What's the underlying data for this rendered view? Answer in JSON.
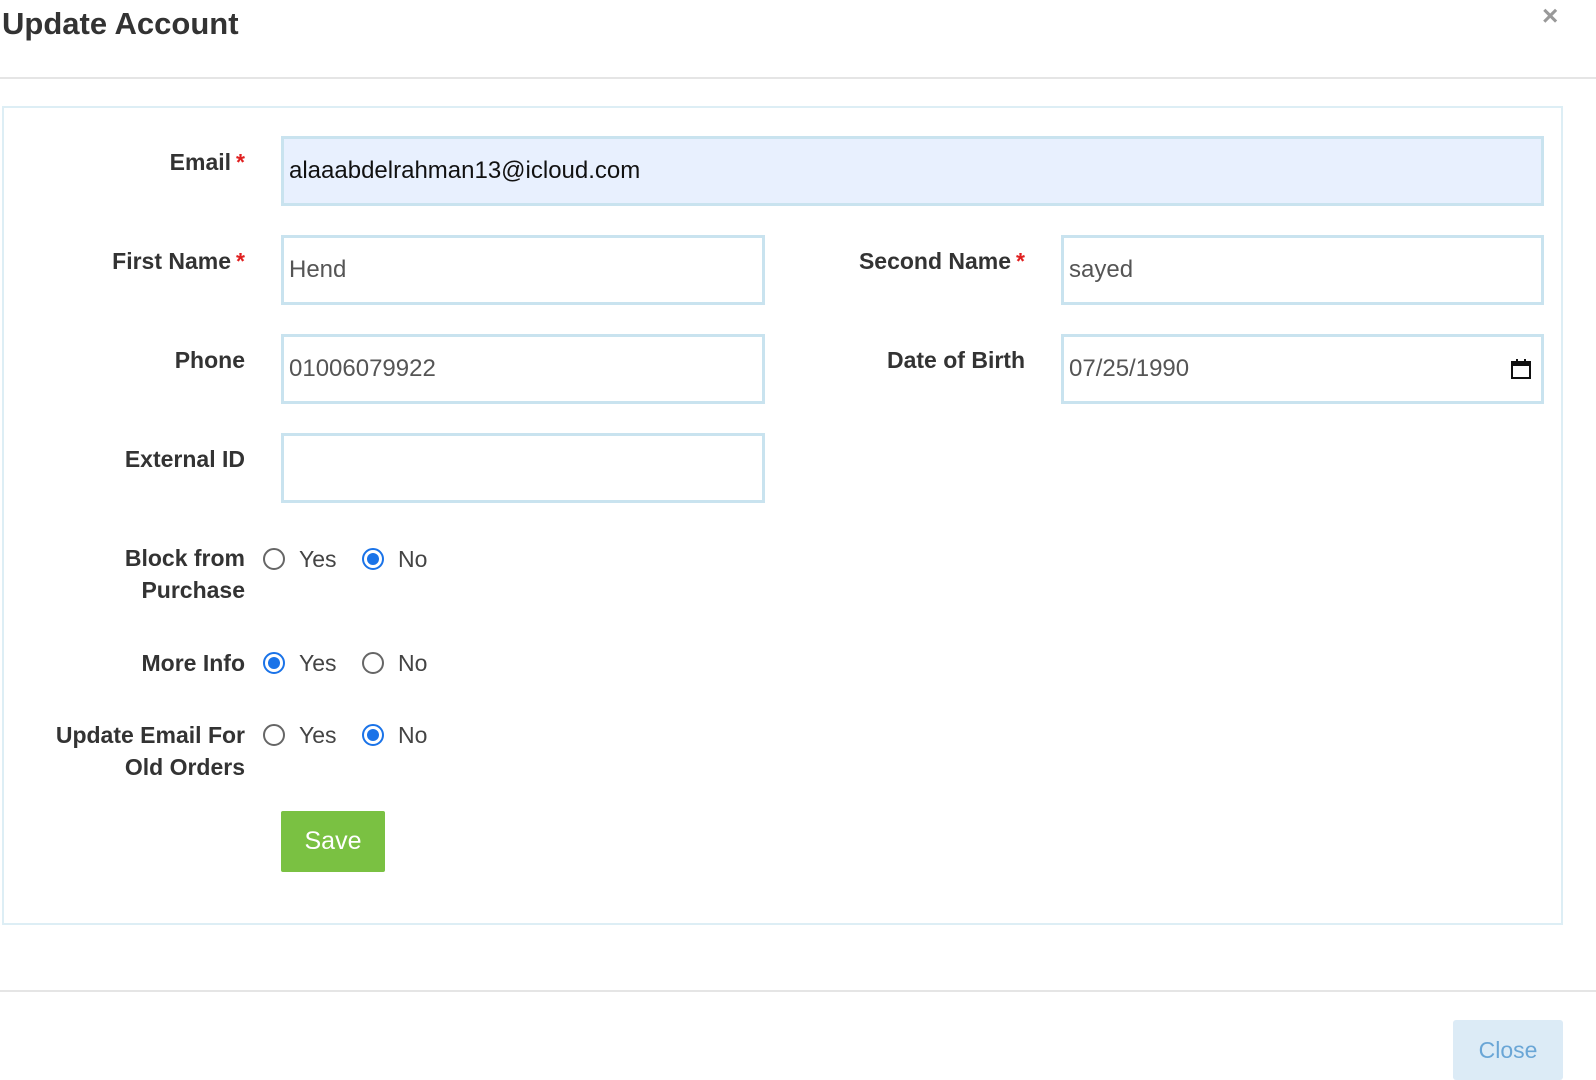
{
  "modal": {
    "title": "Update Account",
    "close_symbol": "×"
  },
  "form": {
    "email": {
      "label": "Email",
      "required_mark": "*",
      "value": "alaaabdelrahman13@icloud.com"
    },
    "first_name": {
      "label": "First Name",
      "required_mark": "*",
      "value": "Hend"
    },
    "second_name": {
      "label": "Second Name",
      "required_mark": "*",
      "value": "sayed"
    },
    "phone": {
      "label": "Phone",
      "value": "01006079922"
    },
    "date_of_birth": {
      "label": "Date of Birth",
      "value": "07/25/1990",
      "icon": "calendar-icon"
    },
    "external_id": {
      "label": "External ID",
      "value": ""
    },
    "block_from_purchase": {
      "label_line1": "Block from",
      "label_line2": "Purchase",
      "options": [
        "Yes",
        "No"
      ],
      "selected": "No"
    },
    "more_info": {
      "label": "More Info",
      "options": [
        "Yes",
        "No"
      ],
      "selected": "Yes"
    },
    "update_email_old_orders": {
      "label_line1": "Update Email For",
      "label_line2": "Old Orders",
      "options": [
        "Yes",
        "No"
      ],
      "selected": "No"
    },
    "save_label": "Save"
  },
  "footer": {
    "close_label": "Close"
  },
  "colors": {
    "save_button": "#7ac142",
    "required": "#e02020",
    "radio_checked": "#1a73e8",
    "input_border": "#c9e3ef",
    "autofill_bg": "#e8f0fe"
  }
}
